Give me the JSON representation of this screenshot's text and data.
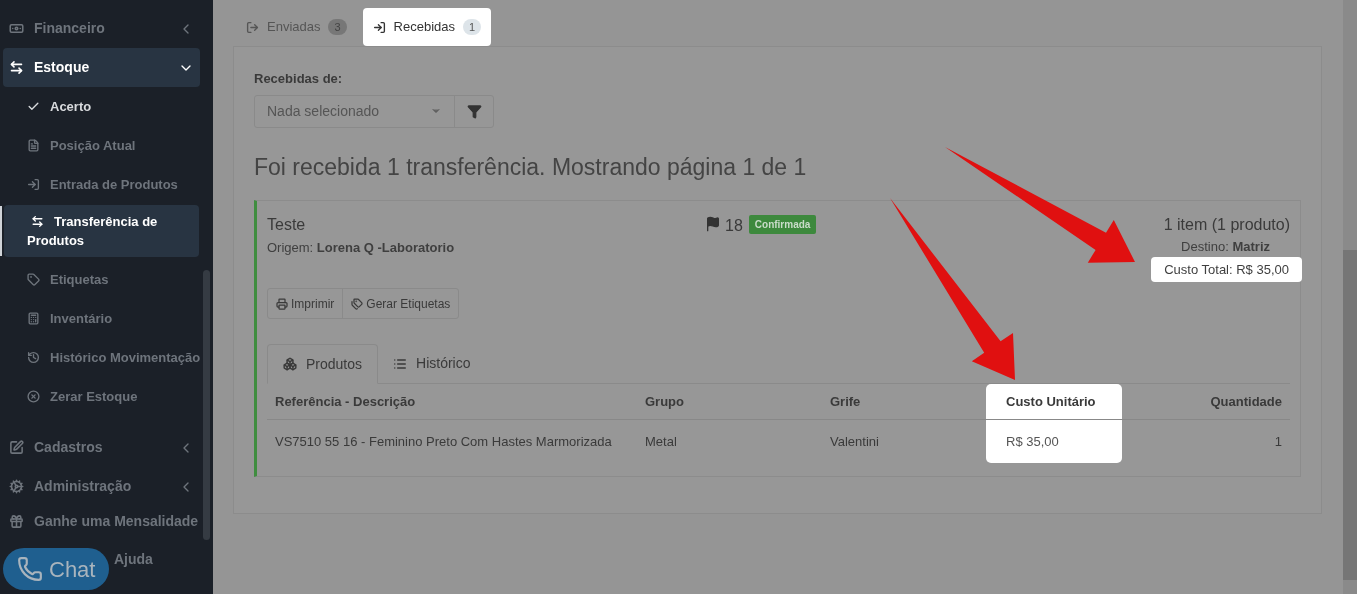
{
  "sidebar": {
    "items": [
      {
        "label": "Financeiro",
        "expanded": false,
        "selected": false
      },
      {
        "label": "Estoque",
        "expanded": true,
        "selected": true,
        "children": [
          {
            "label": "Acerto",
            "selected": false,
            "highlighted": true
          },
          {
            "label": "Posição Atual",
            "selected": false,
            "highlighted": false
          },
          {
            "label": "Entrada de Produtos",
            "selected": false,
            "highlighted": false
          },
          {
            "label": "Transferência de Produtos",
            "selected": true,
            "highlighted": false
          },
          {
            "label": "Etiquetas",
            "selected": false,
            "highlighted": false
          },
          {
            "label": "Inventário",
            "selected": false,
            "highlighted": false
          },
          {
            "label": "Histórico Movimentação",
            "selected": false,
            "highlighted": false
          },
          {
            "label": "Zerar Estoque",
            "selected": false,
            "highlighted": false
          }
        ]
      },
      {
        "label": "Cadastros",
        "expanded": false,
        "selected": false
      },
      {
        "label": "Administração",
        "expanded": false,
        "selected": false
      },
      {
        "label": "Ganhe uma Mensalidade",
        "selected": false
      },
      {
        "label": "Ajuda",
        "selected": false
      }
    ]
  },
  "chat_button": {
    "label": "Chat"
  },
  "tabs": [
    {
      "label": "Enviadas",
      "count": "3",
      "selected": false,
      "spotlight": false
    },
    {
      "label": "Recebidas",
      "count": "1",
      "selected": true,
      "spotlight": true
    }
  ],
  "filter": {
    "label": "Recebidas de:",
    "value": "Nada selecionado"
  },
  "heading": "Foi recebida 1 transferência. Mostrando página 1 de 1",
  "transfer": {
    "title": "Teste",
    "origin_label": "Origem:",
    "origin": "Lorena Q -Laboratorio",
    "flag_count": "18",
    "status": "Confirmada",
    "summary": "1 item (1 produto)",
    "destination_label": "Destino:",
    "destination": "Matriz",
    "total": {
      "text": "Custo Total: R$ 35,00",
      "spotlight": true
    },
    "actions": [
      {
        "label": "Imprimir"
      },
      {
        "label": "Gerar Etiquetas"
      }
    ],
    "inner_tabs": [
      {
        "label": "Produtos",
        "selected": true
      },
      {
        "label": "Histórico",
        "selected": false
      }
    ],
    "table": {
      "columns": [
        {
          "label": "Referência - Descrição",
          "spotlight": false
        },
        {
          "label": "Grupo",
          "spotlight": false
        },
        {
          "label": "Grife",
          "spotlight": false
        },
        {
          "label": "Custo Unitário",
          "spotlight": true
        },
        {
          "label": "Quantidade",
          "spotlight": false
        }
      ],
      "rows": [
        [
          "VS7510 55 16 - Feminino Preto Com Hastes Marmorizada",
          "Metal",
          "Valentini",
          "R$ 35,00",
          "1"
        ]
      ]
    }
  }
}
